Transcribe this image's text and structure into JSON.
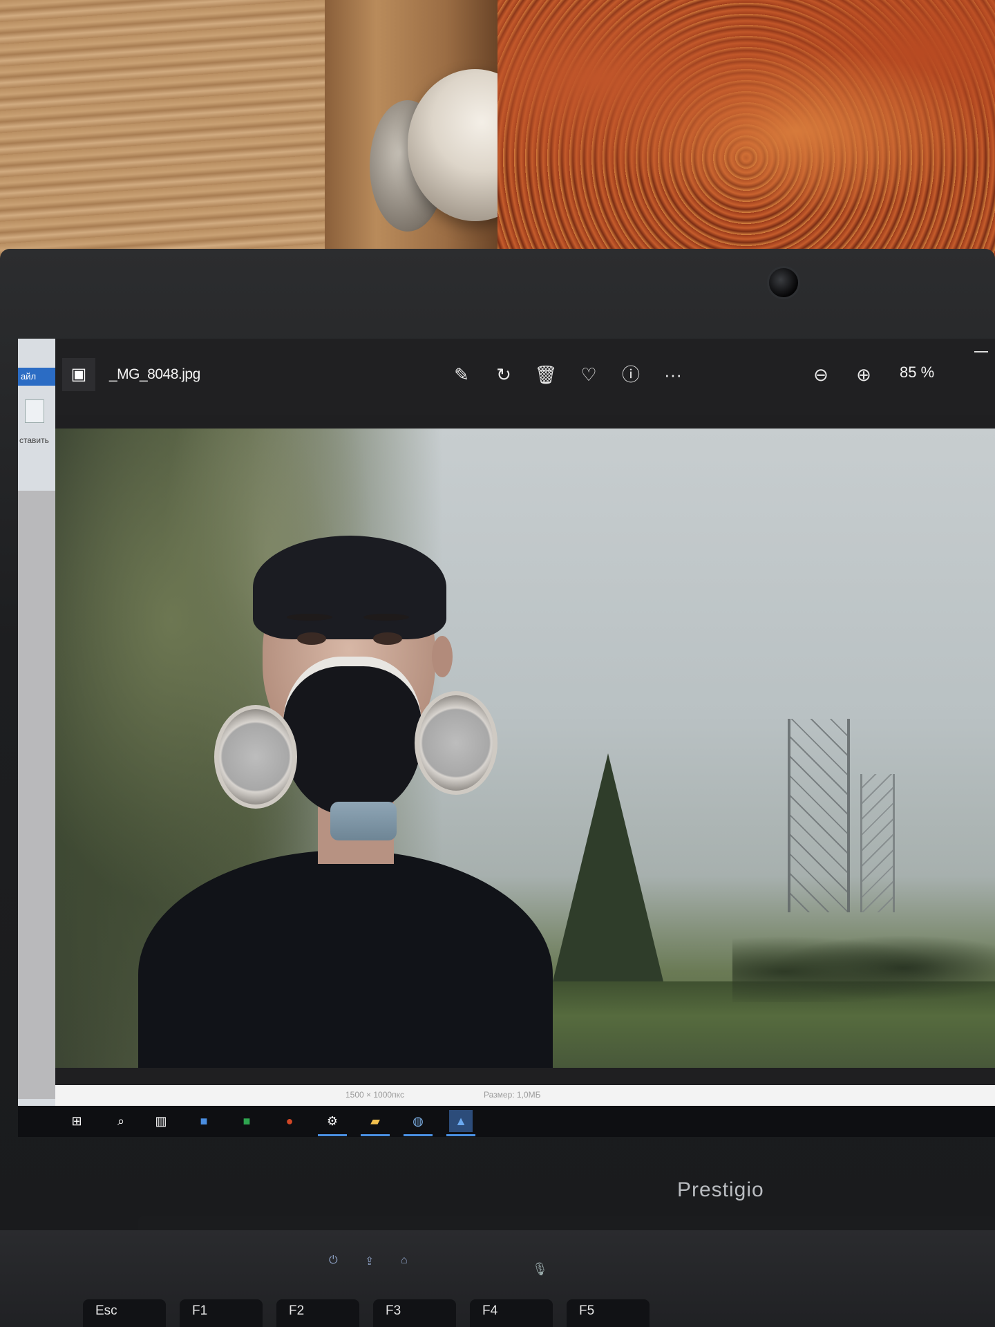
{
  "photos_app": {
    "file_name": "_MG_8048.jpg",
    "zoom": "85 %",
    "toolbar_icons": [
      "edit-icon",
      "rotate-icon",
      "delete-icon",
      "favorite-icon",
      "info-icon",
      "more-icon"
    ],
    "zoom_icons": [
      "zoom-out-icon",
      "zoom-in-icon"
    ],
    "status": {
      "dimensions": "1500 × 1000пкс",
      "size": "Размер: 1,0МБ"
    }
  },
  "side_window": {
    "tab_label": "айл",
    "paste_label": "ставить"
  },
  "taskbar": {
    "apps": [
      "windows-icon",
      "search-icon",
      "task-view-icon",
      "word-icon",
      "excel-icon",
      "powerpoint-icon",
      "settings-icon",
      "explorer-icon",
      "browser-icon",
      "photos-icon"
    ]
  },
  "laptop": {
    "brand": "Prestigio"
  },
  "keyboard": {
    "keys": [
      "Esc",
      "F1",
      "F2",
      "F3",
      "F4",
      "F5"
    ]
  }
}
